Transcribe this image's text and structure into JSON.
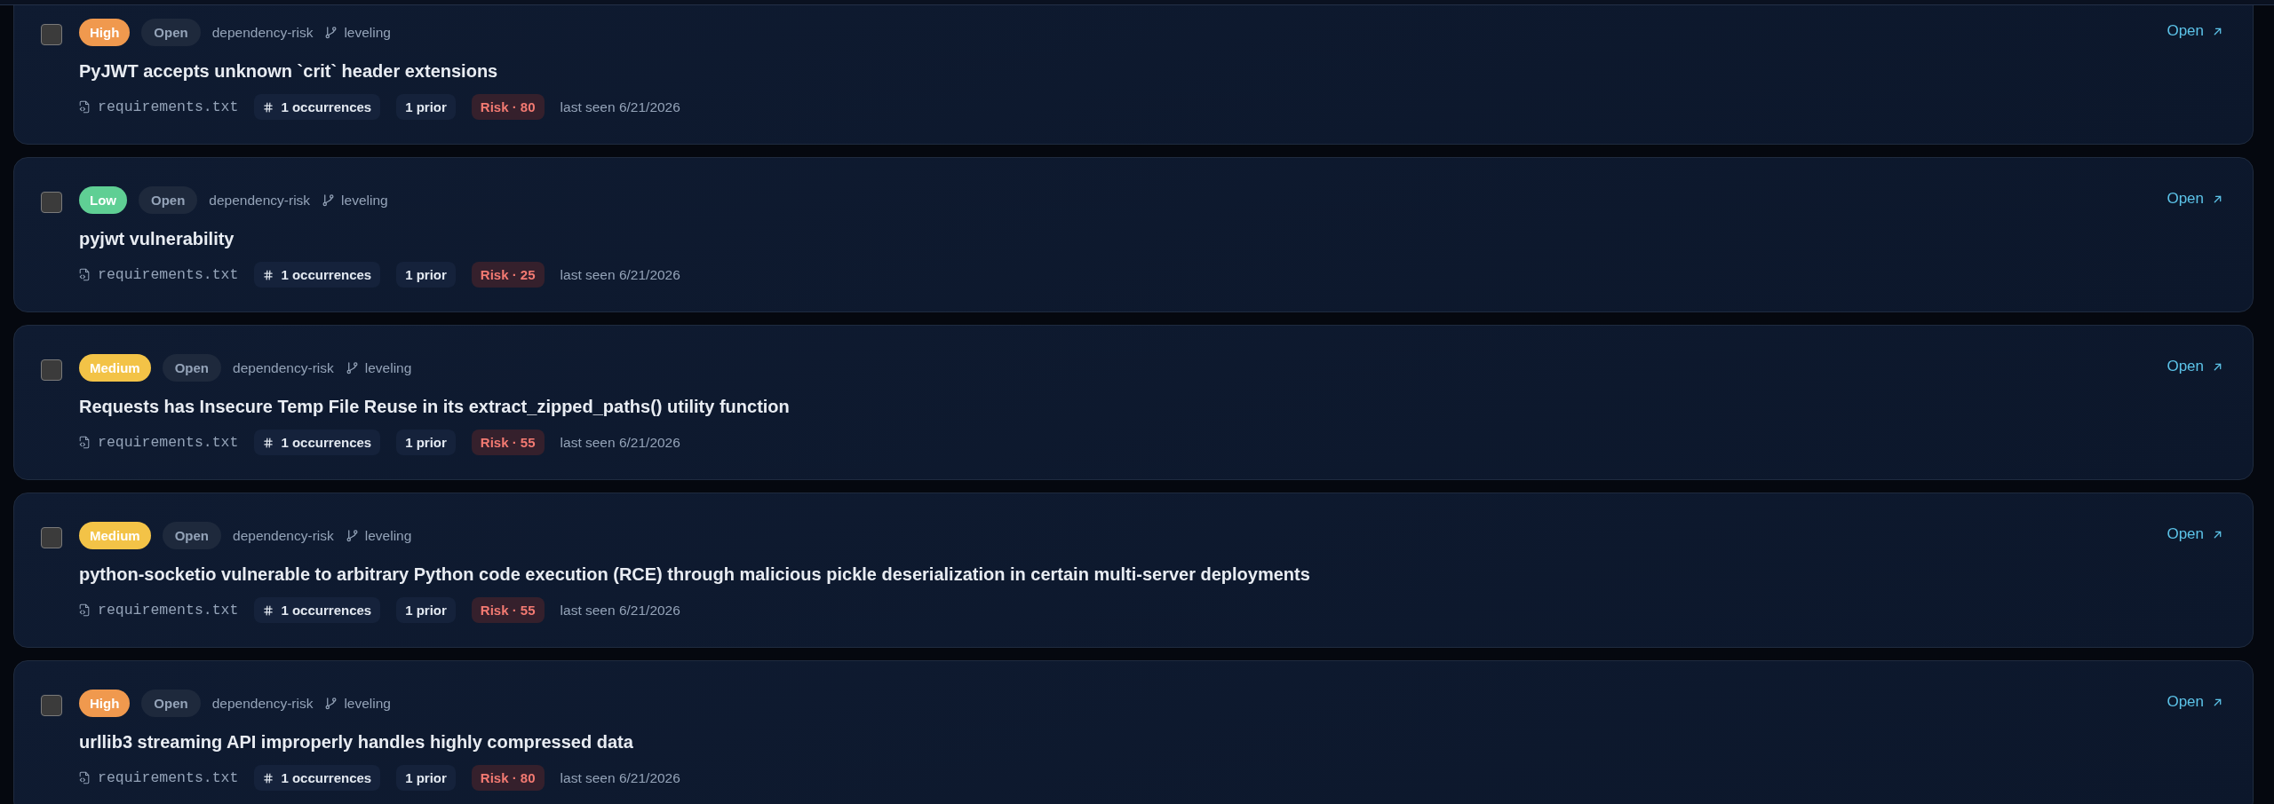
{
  "findings": [
    {
      "checked": false,
      "severity": {
        "label": "High",
        "color": "#f0994e"
      },
      "status": "Open",
      "category": "dependency-risk",
      "branch": "leveling",
      "title": "PyJWT accepts unknown `crit` header extensions",
      "file": "requirements.txt",
      "occurrences": "1 occurrences",
      "prior": "1 prior",
      "risk": "Risk · 80",
      "last_seen": "last seen 6/21/2026",
      "link": "Open"
    },
    {
      "checked": false,
      "severity": {
        "label": "Low",
        "color": "#5fcf94"
      },
      "status": "Open",
      "category": "dependency-risk",
      "branch": "leveling",
      "title": "pyjwt vulnerability",
      "file": "requirements.txt",
      "occurrences": "1 occurrences",
      "prior": "1 prior",
      "risk": "Risk · 25",
      "last_seen": "last seen 6/21/2026",
      "link": "Open"
    },
    {
      "checked": false,
      "severity": {
        "label": "Medium",
        "color": "#f3c347"
      },
      "status": "Open",
      "category": "dependency-risk",
      "branch": "leveling",
      "title": "Requests has Insecure Temp File Reuse in its extract_zipped_paths() utility function",
      "file": "requirements.txt",
      "occurrences": "1 occurrences",
      "prior": "1 prior",
      "risk": "Risk · 55",
      "last_seen": "last seen 6/21/2026",
      "link": "Open"
    },
    {
      "checked": false,
      "severity": {
        "label": "Medium",
        "color": "#f3c347"
      },
      "status": "Open",
      "category": "dependency-risk",
      "branch": "leveling",
      "title": "python-socketio vulnerable to arbitrary Python code execution (RCE) through malicious pickle deserialization in certain multi-server deployments",
      "file": "requirements.txt",
      "occurrences": "1 occurrences",
      "prior": "1 prior",
      "risk": "Risk · 55",
      "last_seen": "last seen 6/21/2026",
      "link": "Open"
    },
    {
      "checked": false,
      "severity": {
        "label": "High",
        "color": "#f0994e"
      },
      "status": "Open",
      "category": "dependency-risk",
      "branch": "leveling",
      "title": "urllib3 streaming API improperly handles highly compressed data",
      "file": "requirements.txt",
      "occurrences": "1 occurrences",
      "prior": "1 prior",
      "risk": "Risk · 80",
      "last_seen": "last seen 6/21/2026",
      "link": "Open"
    }
  ]
}
